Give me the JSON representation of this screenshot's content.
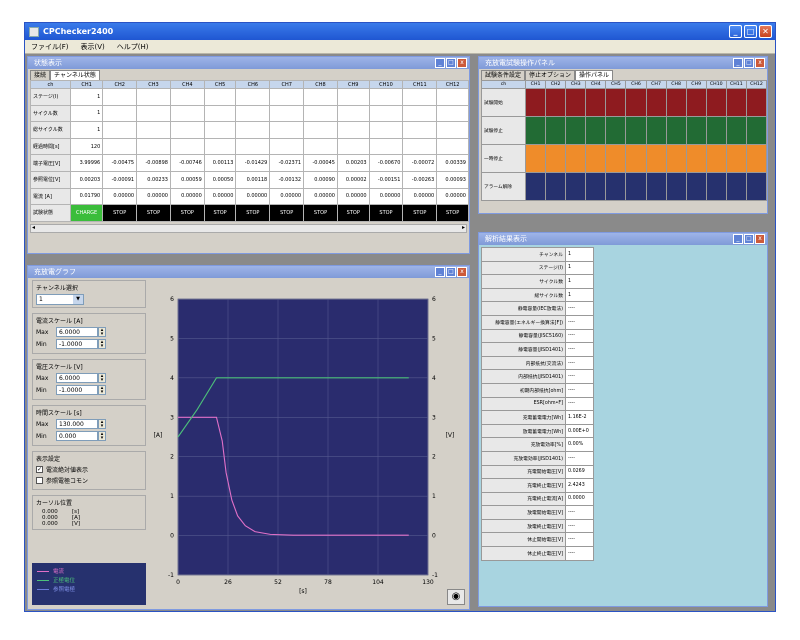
{
  "app": {
    "title": "CPChecker2400",
    "menu": [
      "ファイル(F)",
      "表示(V)",
      "ヘルプ(H)"
    ]
  },
  "status_window": {
    "title": "状態表示",
    "tabs": [
      "接続",
      "チャンネル状態"
    ],
    "columns": [
      "ch",
      "CH1",
      "CH2",
      "CH3",
      "CH4",
      "CH5",
      "CH6",
      "CH7",
      "CH8",
      "CH9",
      "CH10",
      "CH11",
      "CH12"
    ],
    "rows": [
      {
        "label": "ステージ(I)",
        "values": [
          "1",
          "",
          "",
          "",
          "",
          "",
          "",
          "",
          "",
          "",
          "",
          ""
        ]
      },
      {
        "label": "サイクル数",
        "values": [
          "1",
          "",
          "",
          "",
          "",
          "",
          "",
          "",
          "",
          "",
          "",
          ""
        ]
      },
      {
        "label": "総サイクル数",
        "values": [
          "1",
          "",
          "",
          "",
          "",
          "",
          "",
          "",
          "",
          "",
          "",
          ""
        ]
      },
      {
        "label": "経過時間[s]",
        "values": [
          "120",
          "",
          "",
          "",
          "",
          "",
          "",
          "",
          "",
          "",
          "",
          ""
        ]
      },
      {
        "label": "端子電圧[V]",
        "values": [
          "3.99996",
          "-0.00475",
          "-0.00898",
          "-0.00746",
          "0.00113",
          "-0.01429",
          "-0.02371",
          "-0.00045",
          "0.00203",
          "-0.00670",
          "-0.00072",
          "0.00339"
        ]
      },
      {
        "label": "参照電位[V]",
        "values": [
          "0.00203",
          "-0.00091",
          "0.00233",
          "0.00059",
          "0.00050",
          "0.00118",
          "-0.00132",
          "0.00090",
          "0.00002",
          "-0.00151",
          "-0.00263",
          "0.00093"
        ]
      },
      {
        "label": "電流 [A]",
        "values": [
          "0.01790",
          "0.00000",
          "0.00000",
          "0.00000",
          "0.00000",
          "0.00000",
          "0.00000",
          "0.00000",
          "0.00000",
          "0.00000",
          "0.00000",
          "0.00000"
        ]
      }
    ],
    "state_row": {
      "label": "試験状態",
      "values": [
        "CHARGE",
        "STOP",
        "STOP",
        "STOP",
        "STOP",
        "STOP",
        "STOP",
        "STOP",
        "STOP",
        "STOP",
        "STOP",
        "STOP"
      ]
    }
  },
  "test_panel": {
    "title": "充放電試験操作パネル",
    "tabs": [
      "試験条件設定",
      "停止オプション",
      "操作パネル"
    ],
    "columns": [
      "ch",
      "CH1",
      "CH2",
      "CH3",
      "CH4",
      "CH5",
      "CH6",
      "CH7",
      "CH8",
      "CH9",
      "CH10",
      "CH11",
      "CH12"
    ],
    "rows": [
      {
        "label": "試験開始",
        "color": "#8e1b1f"
      },
      {
        "label": "試験停止",
        "color": "#226b34"
      },
      {
        "label": "一時停止",
        "color": "#ef8c2a"
      },
      {
        "label": "アラーム解除",
        "color": "#26316e"
      }
    ]
  },
  "graph_window": {
    "title": "充放電グラフ",
    "channel_select": {
      "label": "チャンネル選択",
      "value": "1"
    },
    "current_scale": {
      "label": "電流スケール [A]",
      "max_label": "Max",
      "max": "6.0000",
      "min_label": "Min",
      "min": "-1.0000"
    },
    "voltage_scale": {
      "label": "電圧スケール [V]",
      "max_label": "Max",
      "max": "6.0000",
      "min_label": "Min",
      "min": "-1.0000"
    },
    "time_scale": {
      "label": "時間スケール [s]",
      "max_label": "Max",
      "max": "130.000",
      "min_label": "Min",
      "min": "0.000"
    },
    "display": {
      "label": "表示設定",
      "options": [
        {
          "label": "電流絶対値表示",
          "checked": true
        },
        {
          "label": "参照電極コモン",
          "checked": false
        }
      ]
    },
    "cursor": {
      "label": "カーソル位置",
      "values": [
        "0.000",
        "0.000",
        "0.000"
      ],
      "units": [
        "[s]",
        "[A]",
        "[V]"
      ]
    },
    "legend": [
      {
        "label": "電流",
        "color": "#e070c8"
      },
      {
        "label": "正極電位",
        "color": "#4cc07a"
      },
      {
        "label": "参照電極",
        "color": "#6a7ad8"
      }
    ],
    "left_axis_unit": "[A]",
    "right_axis_unit": "[V]",
    "x_axis_unit": "[s]"
  },
  "chart_data": {
    "type": "line",
    "xlabel": "[s]",
    "ylabel": "[A]",
    "y2label": "[V]",
    "xlim": [
      0,
      130
    ],
    "ylim": [
      -1,
      6
    ],
    "x_ticks": [
      0,
      26,
      52,
      78,
      104,
      130
    ],
    "y_ticks": [
      -1,
      0,
      1,
      2,
      3,
      4,
      5,
      6
    ],
    "grid": true,
    "series": [
      {
        "name": "電流",
        "color": "#e070c8",
        "x": [
          0,
          5,
          10,
          20,
          23,
          25,
          28,
          31,
          35,
          40,
          48,
          60,
          80,
          100,
          120
        ],
        "y": [
          3,
          3,
          3,
          3,
          2.4,
          1.6,
          0.9,
          0.5,
          0.25,
          0.1,
          0.03,
          0.01,
          0.01,
          0.01,
          0.01
        ]
      },
      {
        "name": "正極電位",
        "color": "#4cc07a",
        "x": [
          0,
          10,
          20,
          40,
          60,
          80,
          100,
          120
        ],
        "y": [
          2.5,
          3.2,
          4,
          4,
          4,
          4,
          4,
          4
        ]
      }
    ]
  },
  "analysis_window": {
    "title": "解析結果表示",
    "rows": [
      {
        "label": "チャンネル",
        "value": "1"
      },
      {
        "label": "ステージ(I)",
        "value": "1"
      },
      {
        "label": "サイクル数",
        "value": "1"
      },
      {
        "label": "総サイクル数",
        "value": "1"
      },
      {
        "label": "静電容量(IEC放電法)",
        "value": "----"
      },
      {
        "label": "静電容量(エネルギー換算法[F])",
        "value": "----"
      },
      {
        "label": "静電容量(JISC5160)",
        "value": "----"
      },
      {
        "label": "静電容量(JISD1401)",
        "value": "----"
      },
      {
        "label": "内部抵抗(交流法)",
        "value": "----"
      },
      {
        "label": "内部抵抗(JISD1401)",
        "value": "----"
      },
      {
        "label": "初期内部抵抗[ohm]",
        "value": "----"
      },
      {
        "label": "ESR[ohm•F]",
        "value": "----"
      },
      {
        "label": "充電蓄電電力[Wh]",
        "value": "1.16E-2"
      },
      {
        "label": "放電蓄電電力[Wh]",
        "value": "0.00E+0"
      },
      {
        "label": "充放電効率[%]",
        "value": "0.00%"
      },
      {
        "label": "充放電効率(JISD1401)",
        "value": "----"
      },
      {
        "label": "充電開始電圧[V]",
        "value": "0.0269"
      },
      {
        "label": "充電終止電圧[V]",
        "value": "2.4243"
      },
      {
        "label": "充電終止電流[A]",
        "value": "0.0000"
      },
      {
        "label": "放電開始電圧[V]",
        "value": "----"
      },
      {
        "label": "放電終止電圧[V]",
        "value": "----"
      },
      {
        "label": "休止開始電圧[V]",
        "value": "----"
      },
      {
        "label": "休止終止電圧[V]",
        "value": "----"
      }
    ]
  }
}
